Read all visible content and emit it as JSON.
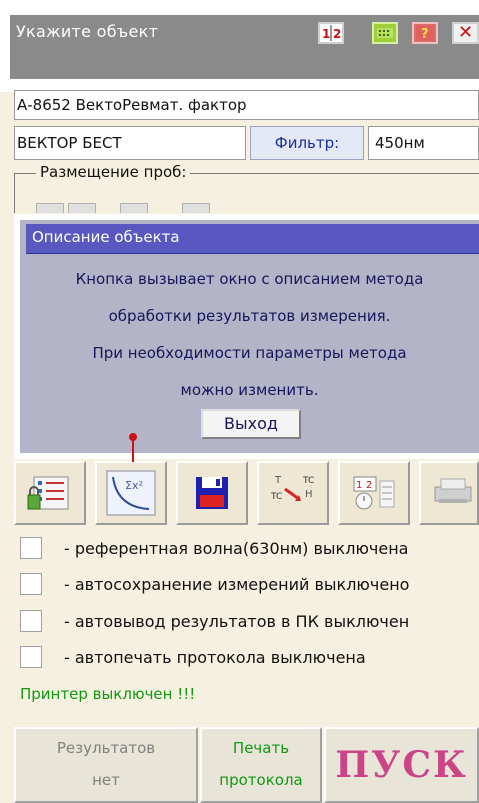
{
  "window": {
    "title": "Укажите объект",
    "icon_12_label": "1|2",
    "close_glyph": "✕"
  },
  "object_field": {
    "value": "А-8652 ВектоРевмат. фактор"
  },
  "device_field": {
    "value": "ВЕКТОР БЕСТ"
  },
  "filter_button": {
    "label": "Фильтр:"
  },
  "wavelength_field": {
    "value": "450нм"
  },
  "placement": {
    "label": "Размещение проб:"
  },
  "popup": {
    "title": "Описание объекта",
    "lines": [
      "Кнопка вызывает окно с описанием метода",
      "обработки результатов измерения.",
      "При необходимости параметры метода",
      "можно изменить."
    ],
    "exit_label": "Выход"
  },
  "toolbar": {
    "buttons": [
      {
        "name": "settings-list-icon"
      },
      {
        "name": "curve-fit-icon"
      },
      {
        "name": "save-floppy-icon"
      },
      {
        "name": "temperature-correction-icon"
      },
      {
        "name": "timer-12-icon"
      },
      {
        "name": "printer-icon"
      }
    ],
    "tc_top": "T",
    "tc_label": "TC",
    "tc_h": "H",
    "tc_left": "TC"
  },
  "options": [
    {
      "label": "- референтная волна(630нм) выключена",
      "checked": false
    },
    {
      "label": "- автосохранение измерений выключено",
      "checked": false
    },
    {
      "label": "- автовывод результатов в ПК выключен",
      "checked": false
    },
    {
      "label": "- автопечать протокола выключена",
      "checked": false
    }
  ],
  "printer_status": "Принтер выключен !!!",
  "bottom": {
    "results_line1": "Результатов",
    "results_line2": "нет",
    "print_line1": "Печать",
    "print_line2": "протокола",
    "start_label": "ПУСК"
  },
  "colors": {
    "background": "#f6f0e0",
    "title_bar": "#8a8a8a",
    "popup_titlebar": "#5858c0",
    "status_green": "#119911",
    "start_pink": "#cc4488",
    "indicator_red": "#cc1111"
  }
}
